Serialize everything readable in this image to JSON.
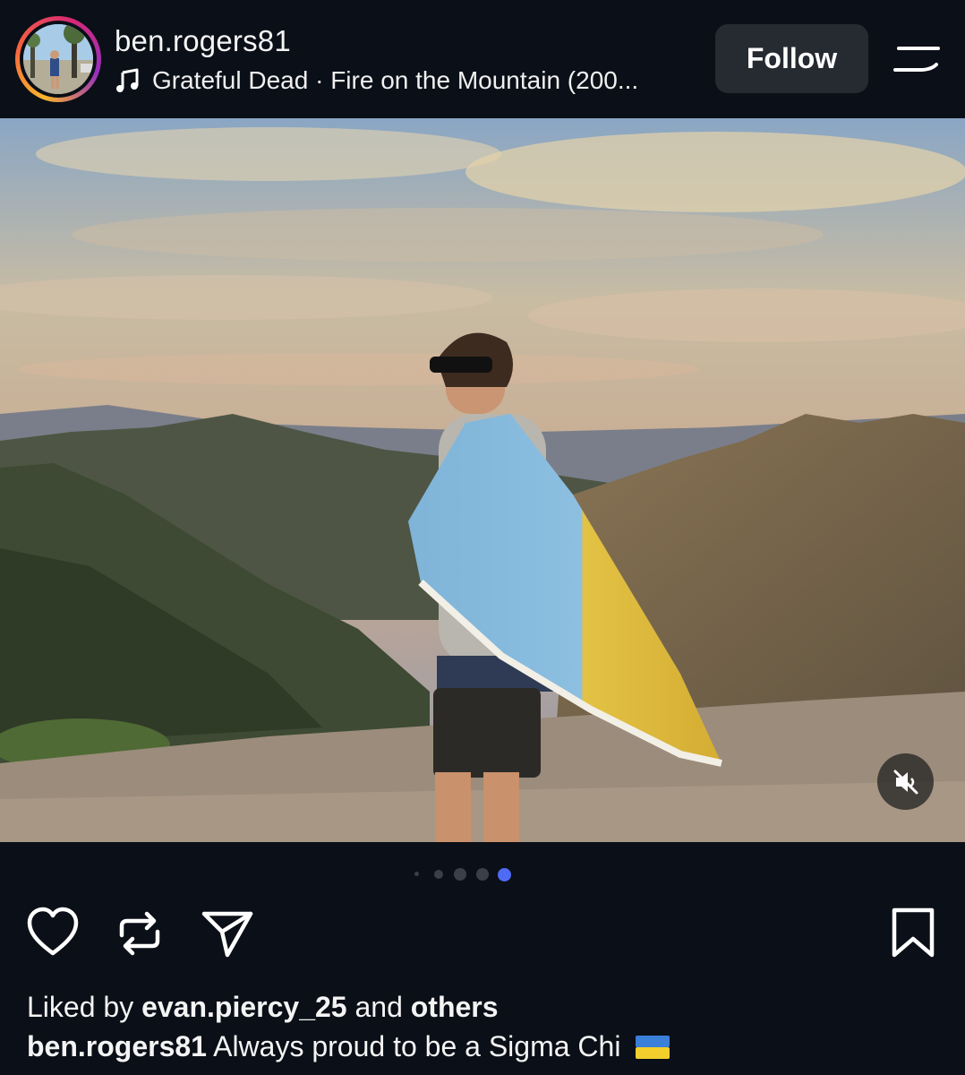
{
  "post": {
    "username": "ben.rogers81",
    "song": "Grateful Dead · Fire on the Mountain (200...",
    "follow_label": "Follow",
    "carousel": {
      "count": 5,
      "active_index": 4
    },
    "liked_by_prefix": "Liked by",
    "liked_by_user": "evan.piercy_25",
    "liked_by_and": "and",
    "liked_by_others": "others",
    "caption_user": "ben.rogers81",
    "caption_text": "Always proud to be a Sigma Chi",
    "caption_flag": "ukraine-flag"
  },
  "icons": {
    "music": "music-note-icon",
    "menu": "menu-icon",
    "mute": "muted-speaker-icon",
    "like": "heart-icon",
    "repost": "repost-icon",
    "share": "send-icon",
    "save": "bookmark-icon"
  },
  "colors": {
    "background": "#0b0f17",
    "follow_button": "#262a31",
    "dot_active": "#4f6bf4",
    "dot_inactive": "#3b3f47"
  }
}
